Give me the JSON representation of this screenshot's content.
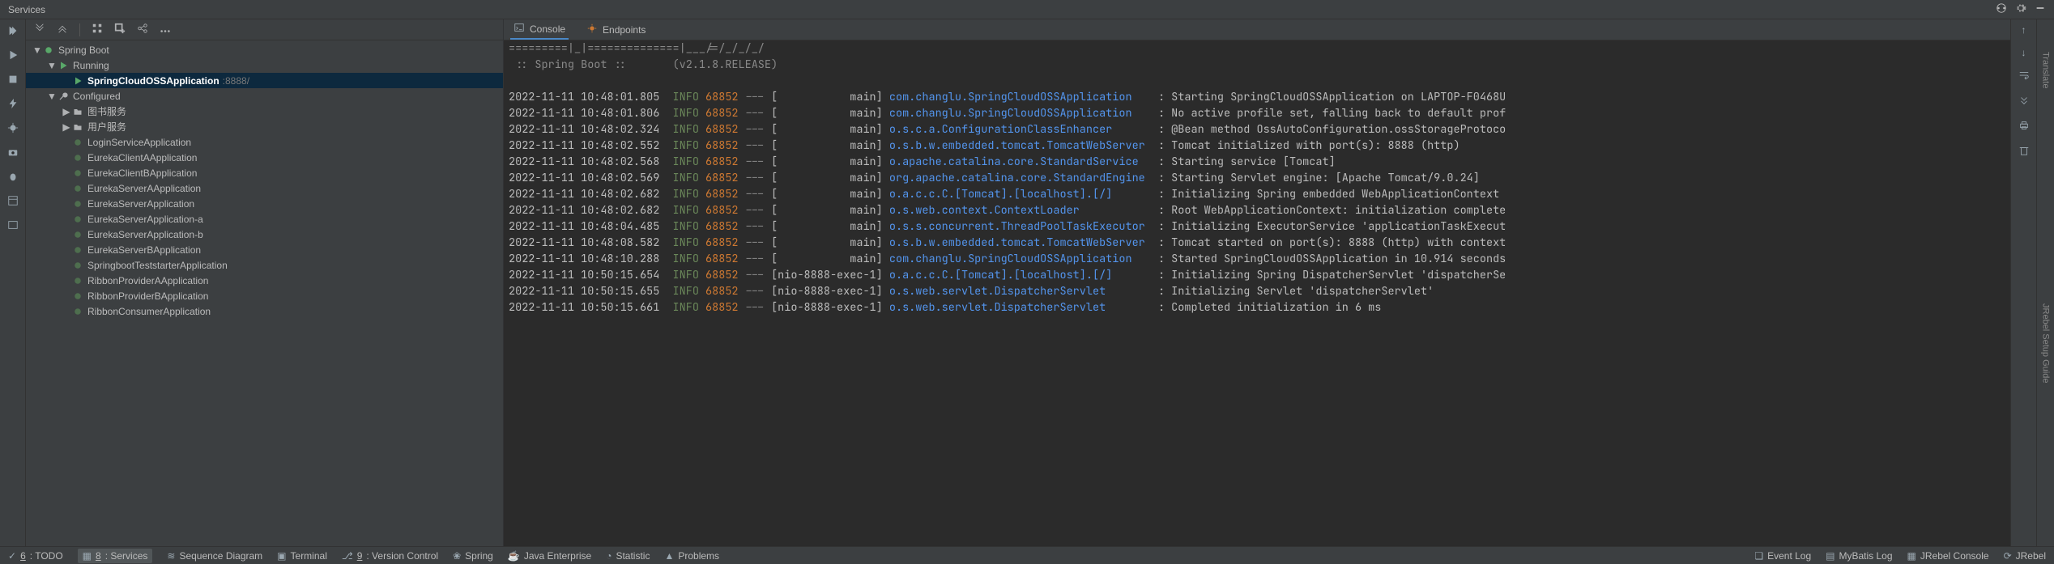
{
  "titlebar": {
    "title": "Services"
  },
  "tree": {
    "root": "Spring Boot",
    "running_label": "Running",
    "running_selected": {
      "name": "SpringCloudOSSApplication",
      "port": ":8888/"
    },
    "configured_label": "Configured",
    "folders": [
      "图书服务",
      "用户服务"
    ],
    "configured_items": [
      "LoginServiceApplication",
      "EurekaClientAApplication",
      "EurekaClientBApplication",
      "EurekaServerAApplication",
      "EurekaServerApplication",
      "EurekaServerApplication-a",
      "EurekaServerApplication-b",
      "EurekaServerBApplication",
      "SpringbootTeststarterApplication",
      "RibbonProviderAApplication",
      "RibbonProviderBApplication",
      "RibbonConsumerApplication"
    ]
  },
  "console_tabs": {
    "console": "Console",
    "endpoints": "Endpoints"
  },
  "banner": {
    "l1": "=========|_|==============|___/=/_/_/_/",
    "l2": " :: Spring Boot ::       (v2.1.8.RELEASE)"
  },
  "logs": [
    {
      "ts": "2022-11-11 10:48:01.805",
      "lvl": "INFO",
      "pid": "68852",
      "thr": "[           main]",
      "cls": "com.changlu.SpringCloudOSSApplication",
      "msg": ": Starting SpringCloudOSSApplication on LAPTOP-F0468U"
    },
    {
      "ts": "2022-11-11 10:48:01.806",
      "lvl": "INFO",
      "pid": "68852",
      "thr": "[           main]",
      "cls": "com.changlu.SpringCloudOSSApplication",
      "msg": ": No active profile set, falling back to default prof"
    },
    {
      "ts": "2022-11-11 10:48:02.324",
      "lvl": "INFO",
      "pid": "68852",
      "thr": "[           main]",
      "cls": "o.s.c.a.ConfigurationClassEnhancer",
      "msg": ": @Bean method OssAutoConfiguration.ossStorageProtoco"
    },
    {
      "ts": "2022-11-11 10:48:02.552",
      "lvl": "INFO",
      "pid": "68852",
      "thr": "[           main]",
      "cls": "o.s.b.w.embedded.tomcat.TomcatWebServer",
      "msg": ": Tomcat initialized with port(s): 8888 (http)"
    },
    {
      "ts": "2022-11-11 10:48:02.568",
      "lvl": "INFO",
      "pid": "68852",
      "thr": "[           main]",
      "cls": "o.apache.catalina.core.StandardService",
      "msg": ": Starting service [Tomcat]"
    },
    {
      "ts": "2022-11-11 10:48:02.569",
      "lvl": "INFO",
      "pid": "68852",
      "thr": "[           main]",
      "cls": "org.apache.catalina.core.StandardEngine",
      "msg": ": Starting Servlet engine: [Apache Tomcat/9.0.24]"
    },
    {
      "ts": "2022-11-11 10:48:02.682",
      "lvl": "INFO",
      "pid": "68852",
      "thr": "[           main]",
      "cls": "o.a.c.c.C.[Tomcat].[localhost].[/]",
      "msg": ": Initializing Spring embedded WebApplicationContext"
    },
    {
      "ts": "2022-11-11 10:48:02.682",
      "lvl": "INFO",
      "pid": "68852",
      "thr": "[           main]",
      "cls": "o.s.web.context.ContextLoader",
      "msg": ": Root WebApplicationContext: initialization complete"
    },
    {
      "ts": "2022-11-11 10:48:04.485",
      "lvl": "INFO",
      "pid": "68852",
      "thr": "[           main]",
      "cls": "o.s.s.concurrent.ThreadPoolTaskExecutor",
      "msg": ": Initializing ExecutorService 'applicationTaskExecut"
    },
    {
      "ts": "2022-11-11 10:48:08.582",
      "lvl": "INFO",
      "pid": "68852",
      "thr": "[           main]",
      "cls": "o.s.b.w.embedded.tomcat.TomcatWebServer",
      "msg": ": Tomcat started on port(s): 8888 (http) with context"
    },
    {
      "ts": "2022-11-11 10:48:10.288",
      "lvl": "INFO",
      "pid": "68852",
      "thr": "[           main]",
      "cls": "com.changlu.SpringCloudOSSApplication",
      "msg": ": Started SpringCloudOSSApplication in 10.914 seconds"
    },
    {
      "ts": "2022-11-11 10:50:15.654",
      "lvl": "INFO",
      "pid": "68852",
      "thr": "[nio-8888-exec-1]",
      "cls": "o.a.c.c.C.[Tomcat].[localhost].[/]",
      "msg": ": Initializing Spring DispatcherServlet 'dispatcherSe"
    },
    {
      "ts": "2022-11-11 10:50:15.655",
      "lvl": "INFO",
      "pid": "68852",
      "thr": "[nio-8888-exec-1]",
      "cls": "o.s.web.servlet.DispatcherServlet",
      "msg": ": Initializing Servlet 'dispatcherServlet'"
    },
    {
      "ts": "2022-11-11 10:50:15.661",
      "lvl": "INFO",
      "pid": "68852",
      "thr": "[nio-8888-exec-1]",
      "cls": "o.s.web.servlet.DispatcherServlet",
      "msg": ": Completed initialization in 6 ms"
    }
  ],
  "bottom": {
    "left": [
      "6: TODO",
      "8: Services",
      "Sequence Diagram",
      "Terminal",
      "9: Version Control",
      "Spring",
      "Java Enterprise",
      "Statistic",
      "Problems"
    ],
    "right": [
      "Event Log",
      "MyBatis Log",
      "JRebel Console",
      "JRebel"
    ]
  },
  "right_rail": {
    "t1": "Translate",
    "t2": "JRebel Setup Guide"
  }
}
